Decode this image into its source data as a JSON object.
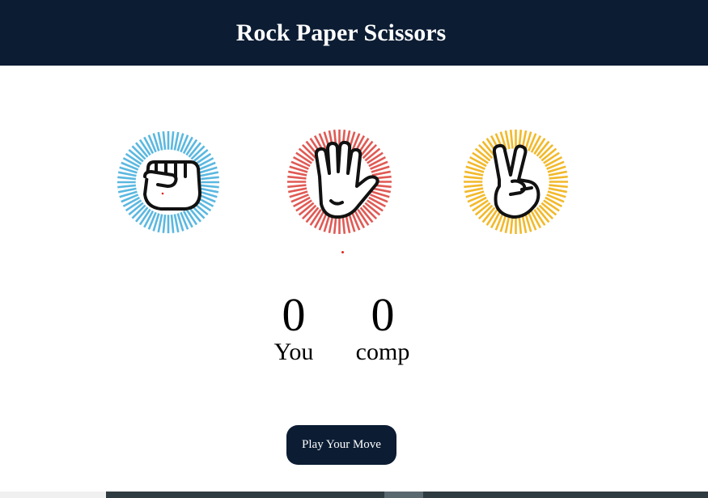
{
  "header": {
    "title": "Rock Paper Scissors",
    "background": "#0b1c33"
  },
  "choices": [
    {
      "id": "rock",
      "icon": "rock-fist-icon",
      "color": "#5bb8e0"
    },
    {
      "id": "paper",
      "icon": "paper-open-hand-icon",
      "color": "#e05a55"
    },
    {
      "id": "scissors",
      "icon": "scissors-peace-hand-icon",
      "color": "#f2b92b"
    }
  ],
  "scores": {
    "you": {
      "value": "0",
      "label": "You"
    },
    "comp": {
      "value": "0",
      "label": "comp"
    }
  },
  "play_button": {
    "label": "Play Your Move"
  }
}
